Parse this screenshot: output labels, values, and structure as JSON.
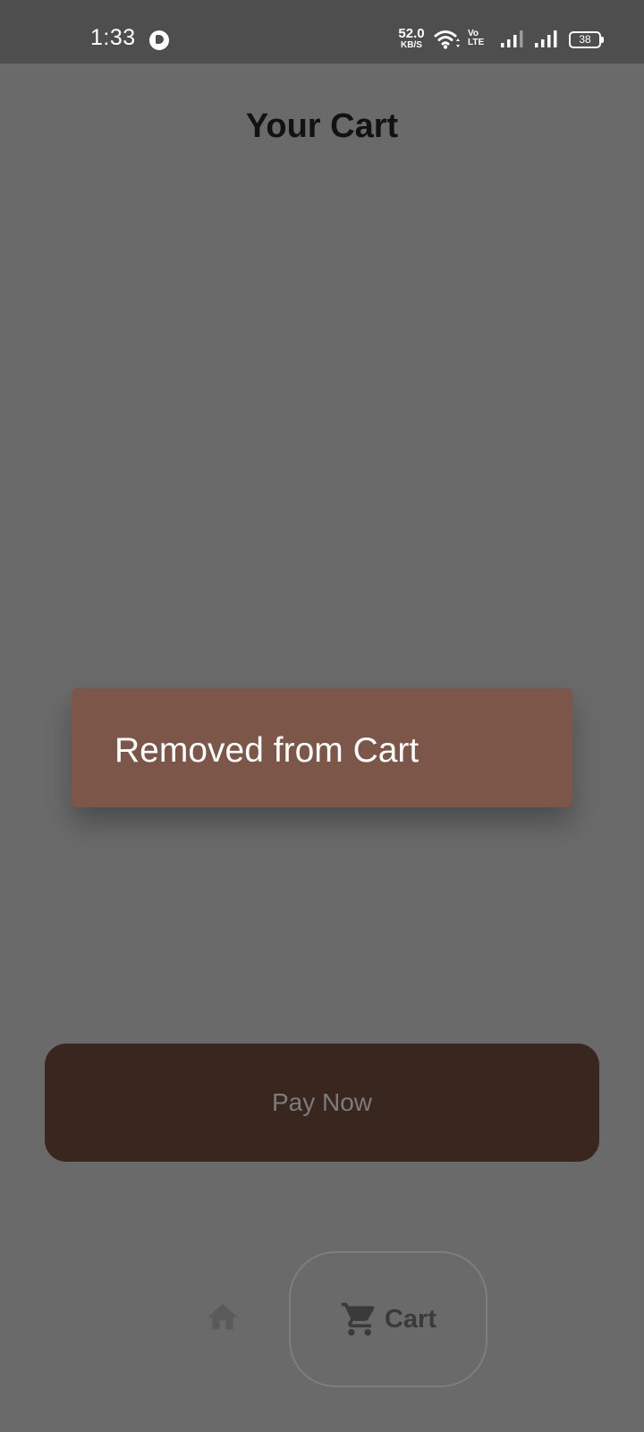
{
  "status_bar": {
    "time": "1:33",
    "net_speed_value": "52.0",
    "net_speed_unit": "KB/S",
    "volte_top": "Vo",
    "volte_bottom": "LTE",
    "battery": "38",
    "icons": [
      "app-notification-icon",
      "wifi-icon",
      "volte-icon",
      "signal-icon",
      "battery-icon"
    ]
  },
  "header": {
    "title": "Your Cart"
  },
  "snackbar": {
    "message": "Removed from Cart",
    "background": "#7b5649"
  },
  "actions": {
    "pay_label": "Pay Now",
    "pay_background": "#38261f"
  },
  "bottom_nav": {
    "items": [
      {
        "icon": "home-icon",
        "label": ""
      },
      {
        "icon": "cart-icon",
        "label": "Cart",
        "selected": true
      }
    ]
  },
  "colors": {
    "scrim": "#6a6a6a",
    "status_bar": "#4e4e4e",
    "title": "#121212"
  }
}
